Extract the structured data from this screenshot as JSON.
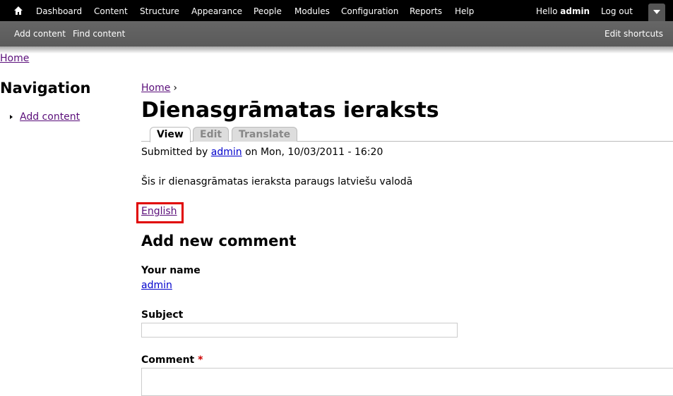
{
  "toolbar": {
    "home_icon": "home-icon",
    "menu": [
      {
        "label": "Dashboard"
      },
      {
        "label": "Content"
      },
      {
        "label": "Structure"
      },
      {
        "label": "Appearance"
      },
      {
        "label": "People"
      },
      {
        "label": "Modules"
      },
      {
        "label": "Configuration"
      },
      {
        "label": "Reports"
      },
      {
        "label": "Help"
      }
    ],
    "hello_prefix": "Hello",
    "username": "admin",
    "logout": "Log out",
    "toggle_icon": "chevron-down-icon"
  },
  "shortcuts": {
    "items": [
      {
        "label": "Add content"
      },
      {
        "label": "Find content"
      }
    ],
    "edit": "Edit shortcuts"
  },
  "top_breadcrumb": {
    "home": "Home"
  },
  "sidebar": {
    "title": "Navigation",
    "items": [
      {
        "label": "Add content"
      }
    ]
  },
  "breadcrumb": {
    "home": "Home",
    "separator": "›"
  },
  "node": {
    "title": "Dienasgrāmatas ieraksts",
    "tabs": [
      {
        "label": "View",
        "active": true
      },
      {
        "label": "Edit",
        "active": false
      },
      {
        "label": "Translate",
        "active": false
      }
    ],
    "submitted_prefix": "Submitted by",
    "author": "admin",
    "submitted_suffix": "on Mon, 10/03/2011 - 16:20",
    "body": "Šis ir dienasgrāmatas ieraksta paraugs latviešu valodā",
    "language_link": "English",
    "highlight_color": "#e00000"
  },
  "comment_form": {
    "title": "Add new comment",
    "your_name_label": "Your name",
    "your_name_value": "admin",
    "subject_label": "Subject",
    "subject_value": "",
    "comment_label": "Comment",
    "required_mark": "*",
    "comment_value": ""
  }
}
